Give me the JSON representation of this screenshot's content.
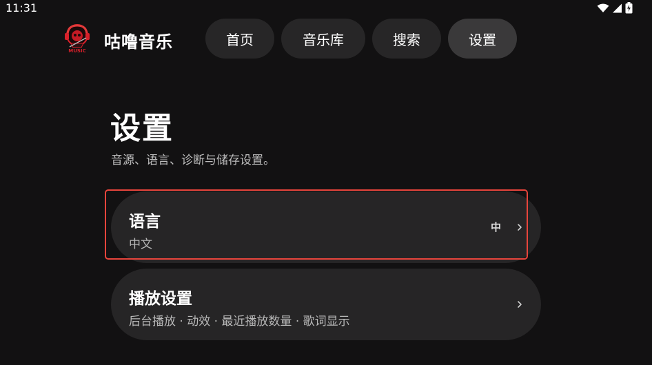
{
  "status_bar": {
    "time": "11:31",
    "icons": [
      "wifi-icon",
      "cellular-signal-icon",
      "battery-charging-icon"
    ]
  },
  "app": {
    "title": "咕噜音乐",
    "logo_text": "MUSIC"
  },
  "nav": {
    "tabs": [
      {
        "label": "首页",
        "active": false
      },
      {
        "label": "音乐库",
        "active": false
      },
      {
        "label": "搜索",
        "active": false
      },
      {
        "label": "设置",
        "active": true
      }
    ]
  },
  "page": {
    "title": "设置",
    "subtitle": "音源、语言、诊断与储存设置。"
  },
  "settings": [
    {
      "title": "语言",
      "subtitle": "中文",
      "value": "中",
      "chevron": "chevron-right-icon",
      "highlighted": true
    },
    {
      "title": "播放设置",
      "subtitle": "后台播放 · 动效 · 最近播放数量 · 歌词显示",
      "chevron": "chevron-right-icon"
    }
  ],
  "colors": {
    "background": "#121112",
    "card": "#262526",
    "tab": "#272627",
    "tab_active": "#3a393a",
    "highlight": "#e8453c",
    "logo_red": "#d8202a"
  }
}
